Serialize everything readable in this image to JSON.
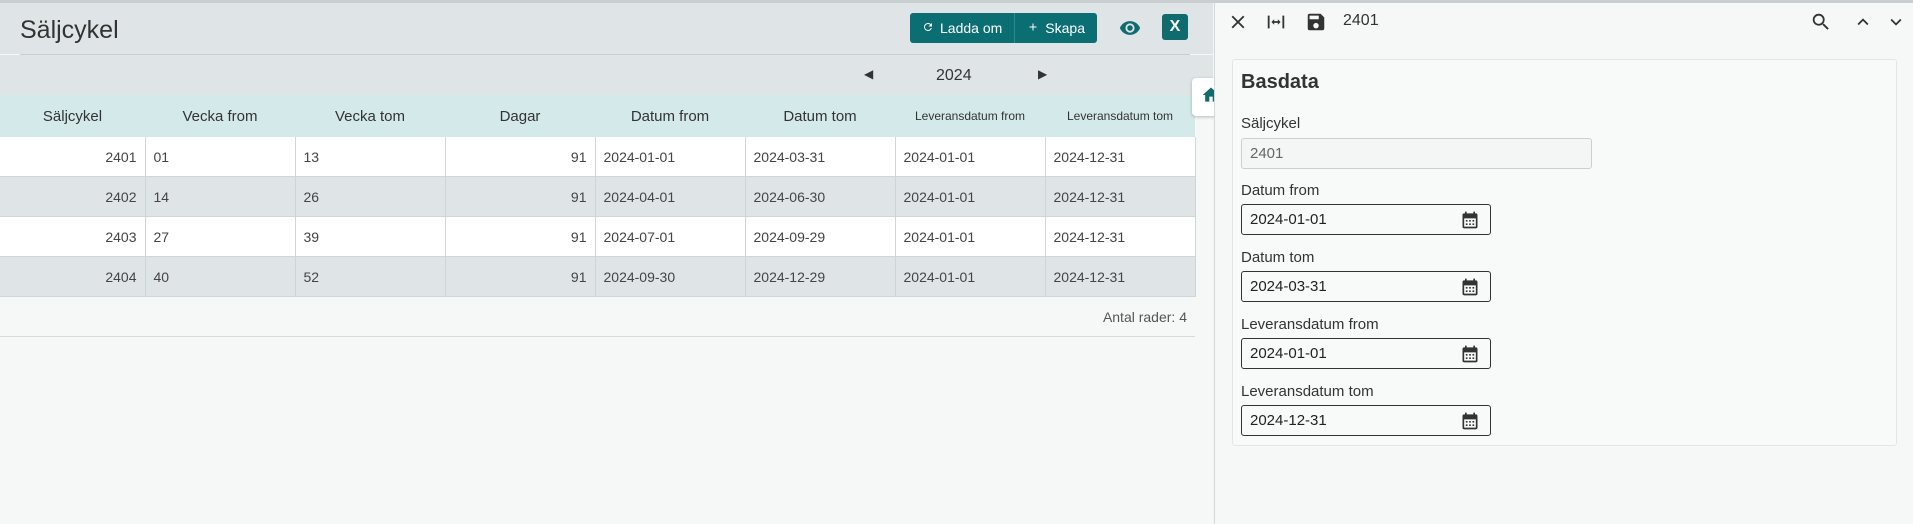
{
  "header": {
    "title": "Säljcykel",
    "reload_label": "Ladda om",
    "create_label": "Skapa",
    "excel_label": "X"
  },
  "year_nav": {
    "year": "2024"
  },
  "table": {
    "columns": [
      "Säljcykel",
      "Vecka from",
      "Vecka tom",
      "Dagar",
      "Datum from",
      "Datum tom",
      "Leveransdatum from",
      "Leveransdatum tom"
    ],
    "rows": [
      [
        "2401",
        "01",
        "13",
        "91",
        "2024-01-01",
        "2024-03-31",
        "2024-01-01",
        "2024-12-31"
      ],
      [
        "2402",
        "14",
        "26",
        "91",
        "2024-04-01",
        "2024-06-30",
        "2024-01-01",
        "2024-12-31"
      ],
      [
        "2403",
        "27",
        "39",
        "91",
        "2024-07-01",
        "2024-09-29",
        "2024-01-01",
        "2024-12-31"
      ],
      [
        "2404",
        "40",
        "52",
        "91",
        "2024-09-30",
        "2024-12-29",
        "2024-01-01",
        "2024-12-31"
      ]
    ],
    "row_count_text": "Antal rader: 4"
  },
  "detail": {
    "record_id": "2401",
    "section_title": "Basdata",
    "fields": [
      {
        "label": "Säljcykel",
        "value": "2401"
      },
      {
        "label": "Datum from",
        "value": "2024-01-01"
      },
      {
        "label": "Datum tom",
        "value": "2024-03-31"
      },
      {
        "label": "Leveransdatum from",
        "value": "2024-01-01"
      },
      {
        "label": "Leveransdatum tom",
        "value": "2024-12-31"
      }
    ]
  },
  "colors": {
    "accent": "#0b6e72",
    "header_bg": "#dfe5e7",
    "table_head": "#d4e9ea"
  },
  "icons": [
    "reload-icon",
    "plus-icon",
    "eye-icon",
    "excel-icon",
    "home-icon",
    "close-icon",
    "expand-width-icon",
    "save-icon",
    "search-icon",
    "chevron-up-icon",
    "chevron-down-icon",
    "calendar-icon",
    "caret-left-icon",
    "caret-right-icon"
  ]
}
